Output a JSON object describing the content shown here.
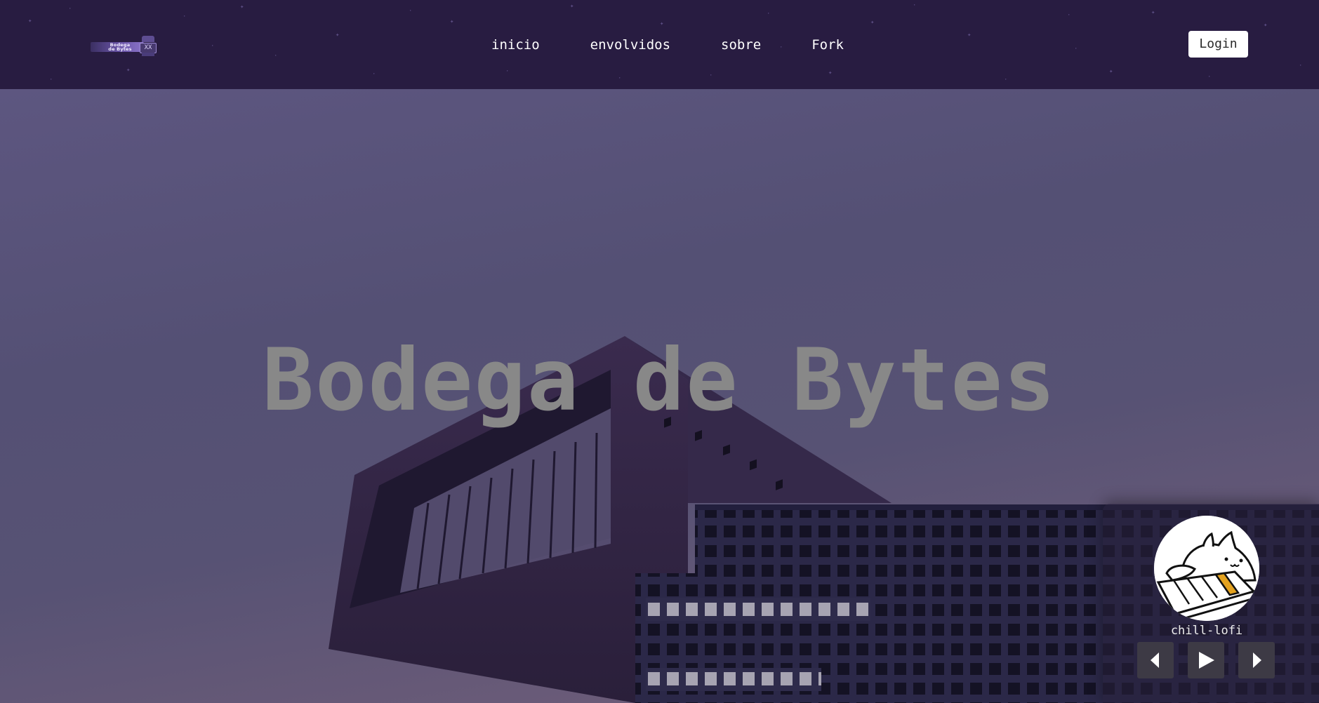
{
  "navbar": {
    "logo_text_line1": "Bodega",
    "logo_text_line2": "de Bytes",
    "logo_box_text": "XX",
    "links": [
      {
        "label": "inicio"
      },
      {
        "label": "envolvidos"
      },
      {
        "label": "sobre"
      },
      {
        "label": "Fork"
      }
    ],
    "login_label": "Login"
  },
  "hero": {
    "title": "Bodega de Bytes"
  },
  "player": {
    "track_title": "chill-lofi",
    "controls": {
      "previous_icon": "triangle-left-icon",
      "play_icon": "play-icon",
      "next_icon": "triangle-right-icon"
    }
  },
  "colors": {
    "navbar_bg": "#281c41",
    "hero_title": "#888888",
    "login_bg": "#ffffff",
    "control_bg": "#3d3a45"
  }
}
